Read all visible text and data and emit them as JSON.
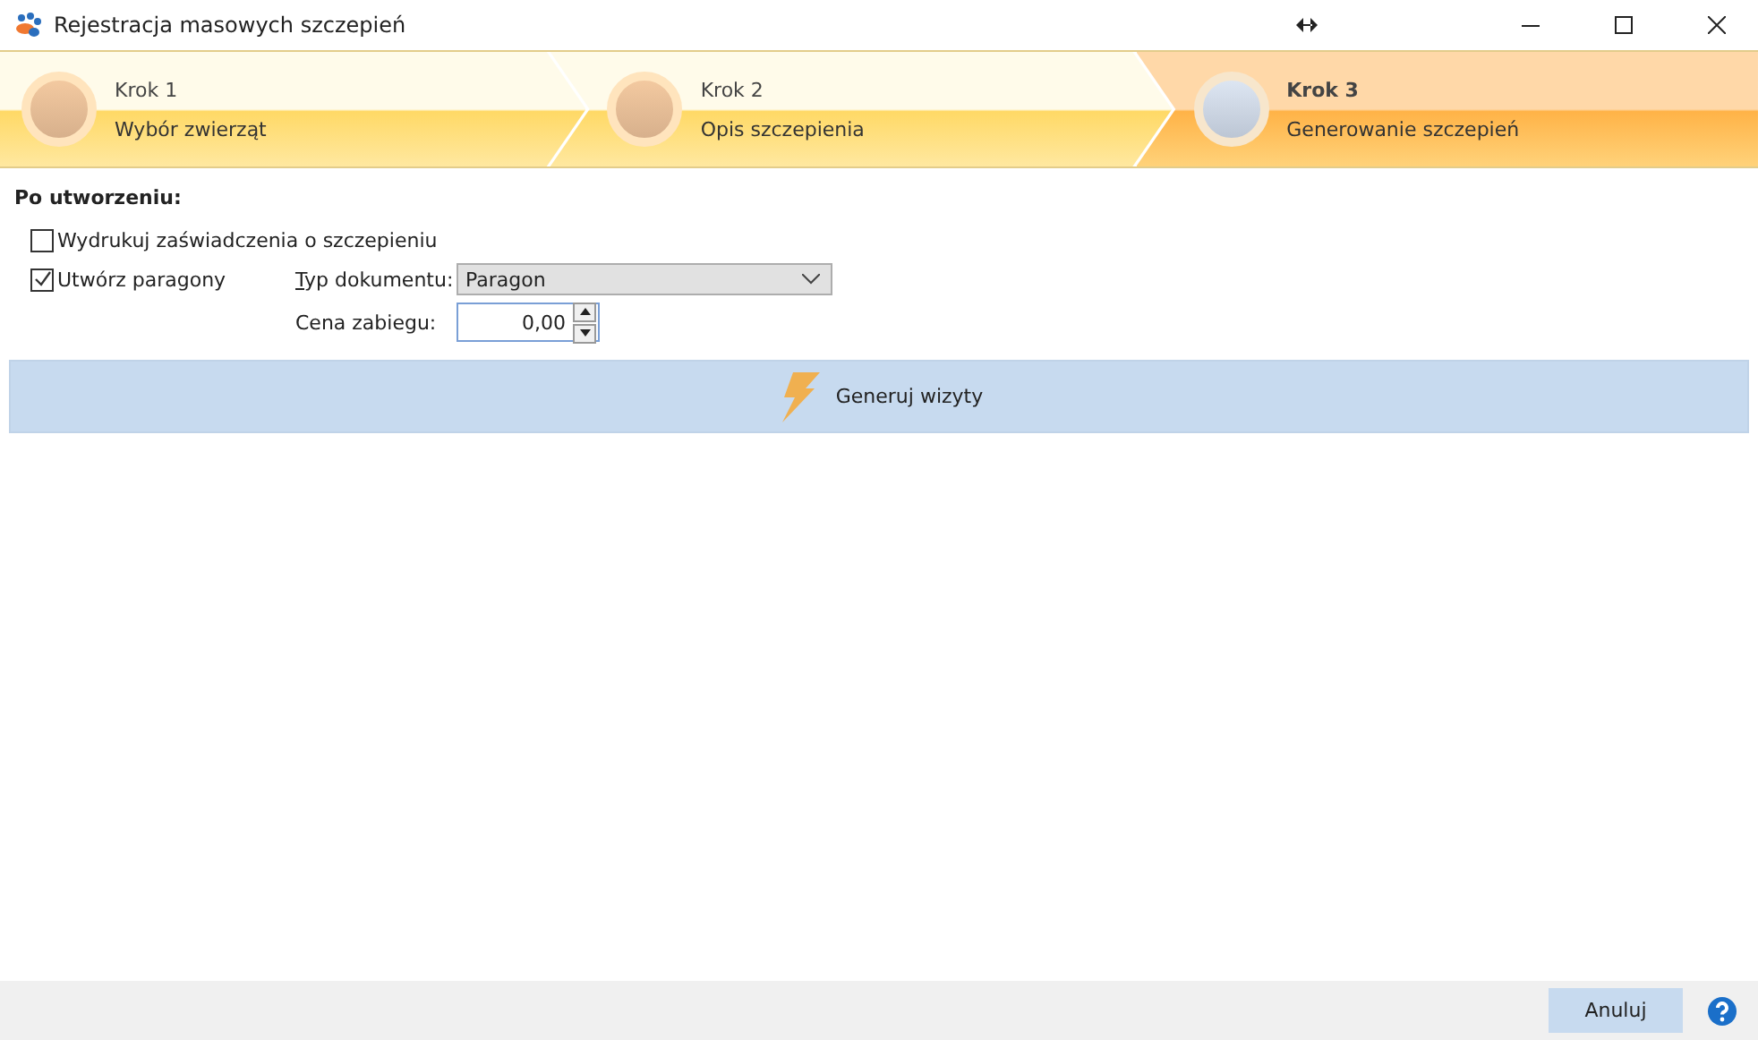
{
  "window": {
    "title": "Rejestracja masowych szczepień"
  },
  "steps": [
    {
      "title": "Krok 1",
      "subtitle": "Wybór zwierząt",
      "selected": false
    },
    {
      "title": "Krok 2",
      "subtitle": "Opis szczepienia",
      "selected": false
    },
    {
      "title": "Krok 3",
      "subtitle": "Generowanie szczepień",
      "selected": true
    }
  ],
  "section": {
    "heading": "Po utworzeniu:"
  },
  "options": [
    {
      "label": "Wydrukuj zaświadczenia o szczepieniu",
      "checked": false
    },
    {
      "label": "Utwórz paragony",
      "checked": true
    }
  ],
  "document_type": {
    "label": "Typ dokumentu:",
    "value": "Paragon"
  },
  "price": {
    "label": "Cena zabiegu:",
    "value": "0,00"
  },
  "generate_button": {
    "label": "Generuj wizyty"
  },
  "footer": {
    "cancel_button": "Anuluj"
  }
}
